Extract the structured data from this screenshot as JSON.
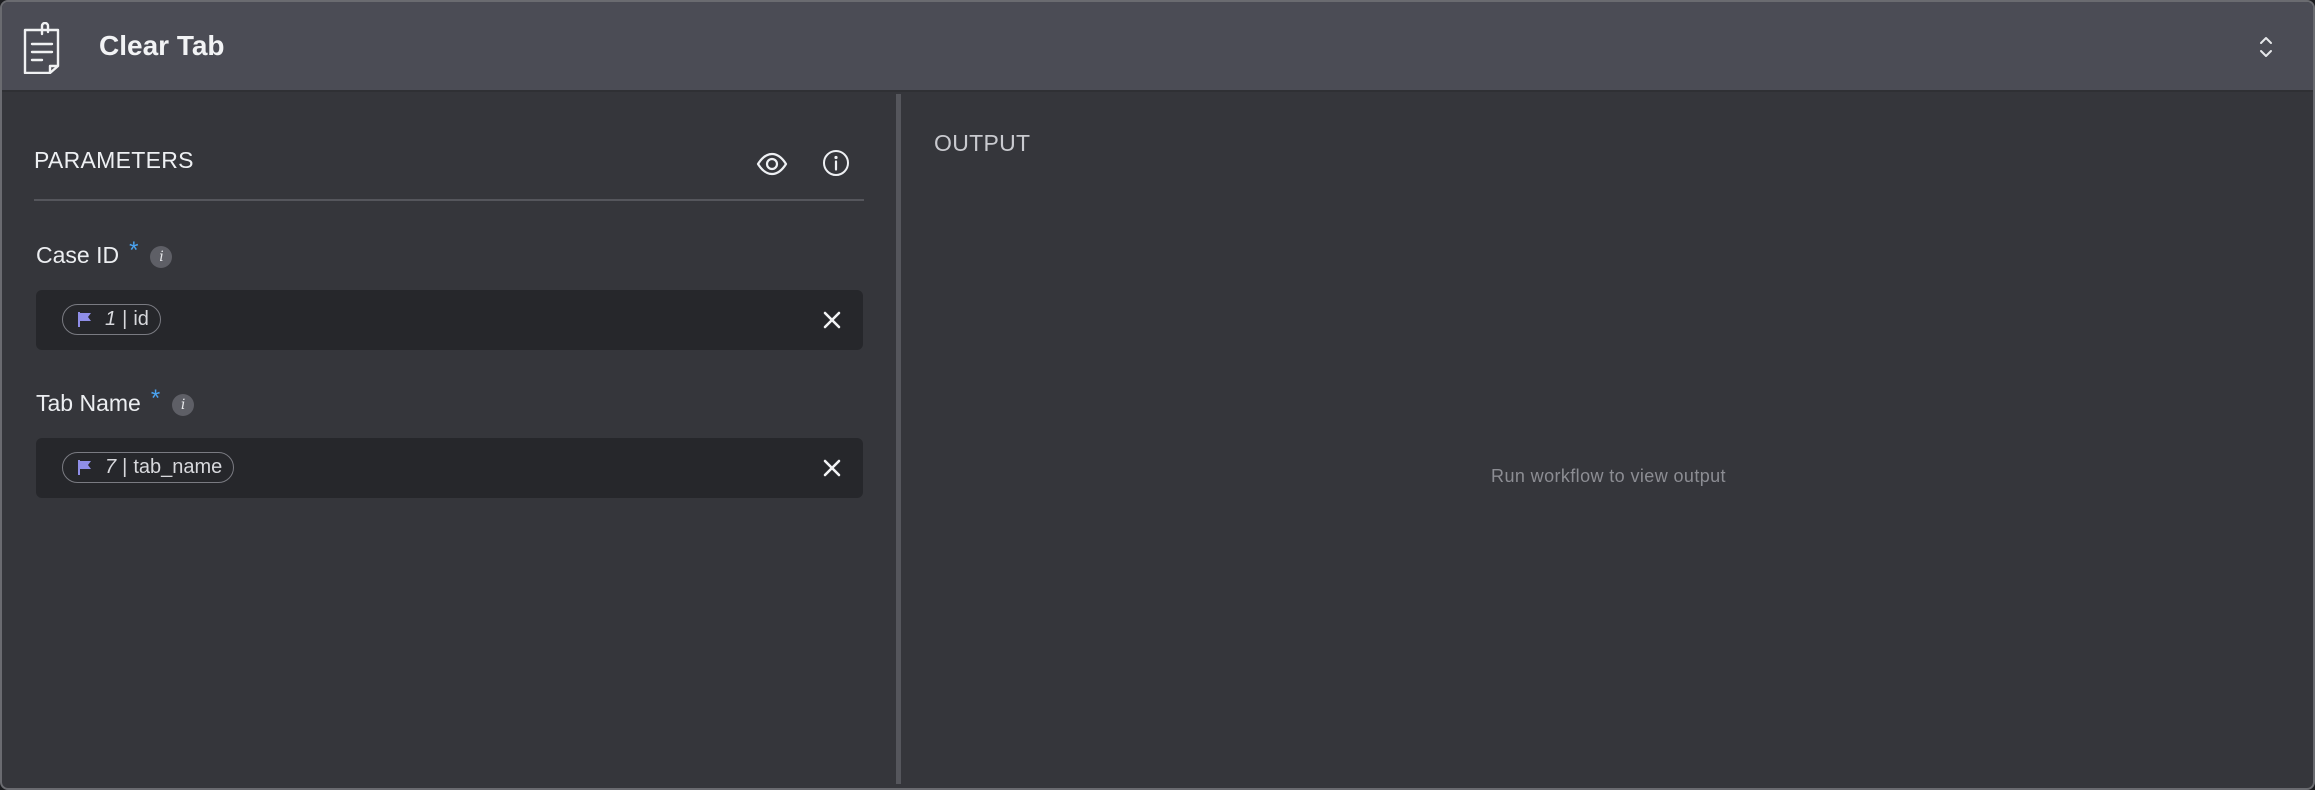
{
  "header": {
    "title": "Clear Tab",
    "icon": "notepad-icon",
    "collapse_icon": "chevron-up-down-icon"
  },
  "parameters": {
    "title": "PARAMETERS",
    "fields": [
      {
        "label": "Case ID",
        "required_mark": "*",
        "hint": "i",
        "chip": {
          "number": "1",
          "separator": "|",
          "value": "id",
          "icon": "flag-icon"
        }
      },
      {
        "label": "Tab Name",
        "required_mark": "*",
        "hint": "i",
        "chip": {
          "number": "7",
          "separator": "|",
          "value": "tab_name",
          "icon": "flag-icon"
        }
      }
    ]
  },
  "output": {
    "title": "OUTPUT",
    "empty_message": "Run workflow to view output"
  },
  "colors": {
    "accent_required": "#4aa3f0",
    "flag": "#8f8ee8",
    "header_bg": "#4b4c55",
    "panel_bg": "#35363b",
    "field_bg": "#26272b"
  }
}
